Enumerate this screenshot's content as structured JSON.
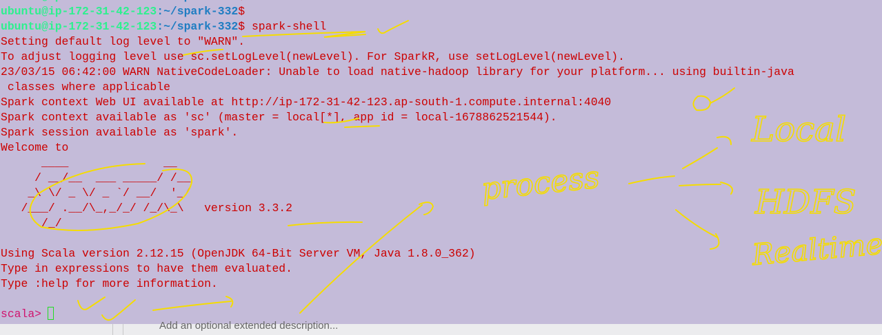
{
  "terminal": {
    "prompt_host": "ubuntu@ip-172-31-42-123",
    "prompt_path": ":~/spark-332",
    "prompt_symbol": "$",
    "command": " spark-shell",
    "output_lines": [
      "Setting default log level to \"WARN\".",
      "To adjust logging level use sc.setLogLevel(newLevel). For SparkR, use setLogLevel(newLevel).",
      "23/03/15 06:42:00 WARN NativeCodeLoader: Unable to load native-hadoop library for your platform... using builtin-java",
      " classes where applicable",
      "Spark context Web UI available at http://ip-172-31-42-123.ap-south-1.compute.internal:4040",
      "Spark context available as 'sc' (master = local[*], app id = local-1678862521544).",
      "Spark session available as 'spark'.",
      "Welcome to"
    ],
    "banner_lines": [
      "      ____              __",
      "     / __/__  ___ _____/ /__",
      "    _\\ \\/ _ \\/ _ `/ __/  '_/",
      "   /___/ .__/\\_,_/_/ /_/\\_\\   version 3.3.2",
      "      /_/"
    ],
    "info_lines": [
      "Using Scala version 2.12.15 (OpenJDK 64-Bit Server VM, Java 1.8.0_362)",
      "Type in expressions to have them evaluated.",
      "Type :help for more information."
    ],
    "scala_prompt": "scala>"
  },
  "annotations": {
    "color": "#f5dc00",
    "words": [
      "process",
      "Local",
      "HDFS",
      "Realtime"
    ]
  },
  "background_window": {
    "description_placeholder": "Add an optional extended description..."
  }
}
